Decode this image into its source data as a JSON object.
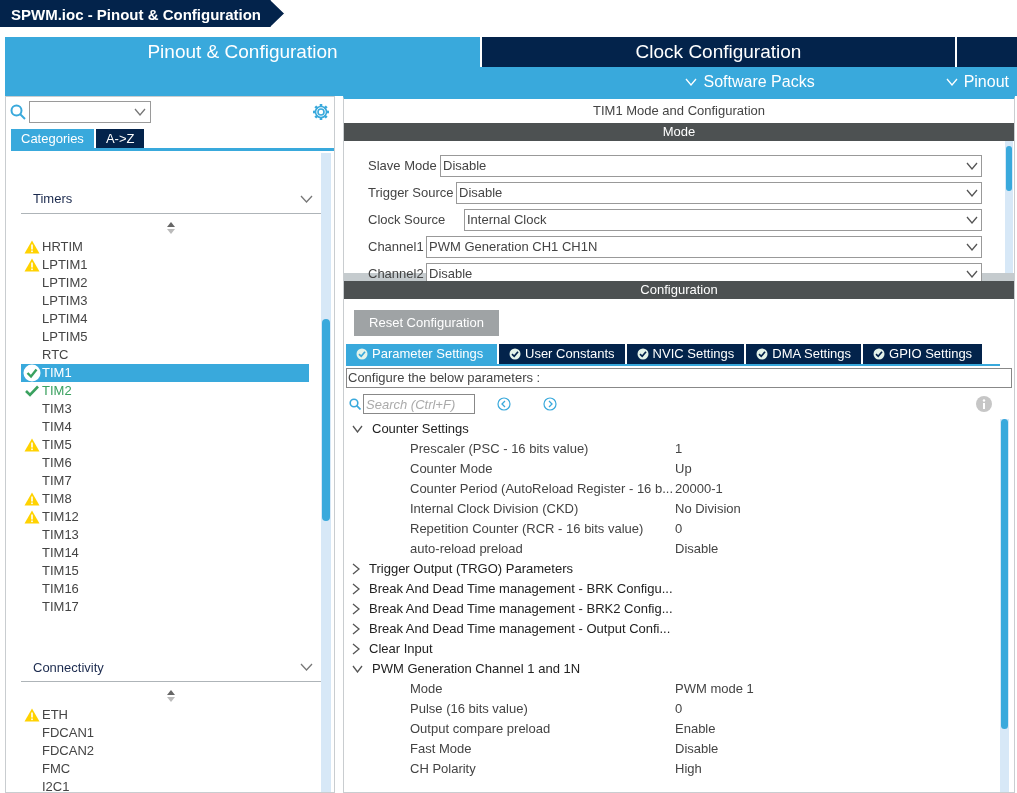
{
  "title_bar": {
    "title": "SPWM.ioc - Pinout & Configuration"
  },
  "main_tabs": [
    {
      "label": "Pinout & Configuration",
      "selected": true
    },
    {
      "label": "Clock Configuration",
      "selected": false
    }
  ],
  "sub_menu": [
    "Software Packs",
    "Pinout"
  ],
  "left_panel": {
    "view_tabs": [
      {
        "label": "Categories",
        "selected": true
      },
      {
        "label": "A->Z",
        "selected": false
      }
    ],
    "categories": [
      {
        "label": "Timers",
        "expanded": true,
        "items": [
          {
            "label": "HRTIM",
            "kind": "warning",
            "selected": false
          },
          {
            "label": "LPTIM1",
            "kind": "warning",
            "selected": false
          },
          {
            "label": "LPTIM2",
            "kind": "plain",
            "selected": false
          },
          {
            "label": "LPTIM3",
            "kind": "plain",
            "selected": false
          },
          {
            "label": "LPTIM4",
            "kind": "plain",
            "selected": false
          },
          {
            "label": "LPTIM5",
            "kind": "plain",
            "selected": false
          },
          {
            "label": "RTC",
            "kind": "plain",
            "selected": false
          },
          {
            "label": "TIM1",
            "kind": "ok",
            "selected": true
          },
          {
            "label": "TIM2",
            "kind": "ok",
            "selected": false
          },
          {
            "label": "TIM3",
            "kind": "plain",
            "selected": false
          },
          {
            "label": "TIM4",
            "kind": "plain",
            "selected": false
          },
          {
            "label": "TIM5",
            "kind": "warning",
            "selected": false
          },
          {
            "label": "TIM6",
            "kind": "plain",
            "selected": false
          },
          {
            "label": "TIM7",
            "kind": "plain",
            "selected": false
          },
          {
            "label": "TIM8",
            "kind": "warning",
            "selected": false
          },
          {
            "label": "TIM12",
            "kind": "warning",
            "selected": false
          },
          {
            "label": "TIM13",
            "kind": "plain",
            "selected": false
          },
          {
            "label": "TIM14",
            "kind": "plain",
            "selected": false
          },
          {
            "label": "TIM15",
            "kind": "plain",
            "selected": false
          },
          {
            "label": "TIM16",
            "kind": "plain",
            "selected": false
          },
          {
            "label": "TIM17",
            "kind": "plain",
            "selected": false
          }
        ]
      },
      {
        "label": "Connectivity",
        "expanded": true,
        "items": [
          {
            "label": "ETH",
            "kind": "warning",
            "selected": false
          },
          {
            "label": "FDCAN1",
            "kind": "plain",
            "selected": false
          },
          {
            "label": "FDCAN2",
            "kind": "plain",
            "selected": false
          },
          {
            "label": "FMC",
            "kind": "plain",
            "selected": false
          },
          {
            "label": "I2C1",
            "kind": "plain",
            "selected": false
          }
        ]
      }
    ]
  },
  "right_panel": {
    "title": "TIM1 Mode and Configuration",
    "mode": {
      "header": "Mode",
      "fields": [
        {
          "label": "Slave Mode",
          "value": "Disable"
        },
        {
          "label": "Trigger Source",
          "value": "Disable"
        },
        {
          "label": "Clock Source",
          "value": "Internal Clock"
        },
        {
          "label": "Channel1",
          "value": "PWM Generation CH1 CH1N"
        },
        {
          "label": "Channel2",
          "value": "Disable"
        }
      ]
    },
    "configuration": {
      "header": "Configuration",
      "reset_button": "Reset Configuration",
      "tabs": [
        {
          "label": "Parameter Settings",
          "selected": true
        },
        {
          "label": "User Constants",
          "selected": false
        },
        {
          "label": "NVIC Settings",
          "selected": false
        },
        {
          "label": "DMA Settings",
          "selected": false
        },
        {
          "label": "GPIO Settings",
          "selected": false
        }
      ],
      "description": "Configure the below parameters :",
      "search": {
        "placeholder": "Search (Ctrl+F)"
      },
      "sections": [
        {
          "label": "Counter Settings",
          "expanded": true,
          "params": [
            {
              "name": "Prescaler (PSC - 16 bits value)",
              "value": "1"
            },
            {
              "name": "Counter Mode",
              "value": "Up"
            },
            {
              "name": "Counter Period (AutoReload Register - 16 b...",
              "value": "20000-1"
            },
            {
              "name": "Internal Clock Division (CKD)",
              "value": "No Division"
            },
            {
              "name": "Repetition Counter (RCR - 16 bits value)",
              "value": "0"
            },
            {
              "name": "auto-reload preload",
              "value": "Disable"
            }
          ]
        },
        {
          "label": "Trigger Output (TRGO) Parameters",
          "expanded": false
        },
        {
          "label": "Break And Dead Time management - BRK Configu...",
          "expanded": false
        },
        {
          "label": "Break And Dead Time management - BRK2 Config...",
          "expanded": false
        },
        {
          "label": "Break And Dead Time management - Output Confi...",
          "expanded": false
        },
        {
          "label": "Clear Input",
          "expanded": false
        },
        {
          "label": "PWM Generation Channel 1 and 1N",
          "expanded": true,
          "params": [
            {
              "name": "Mode",
              "value": "PWM mode 1"
            },
            {
              "name": "Pulse (16 bits value)",
              "value": "0"
            },
            {
              "name": "Output compare preload",
              "value": "Enable"
            },
            {
              "name": "Fast Mode",
              "value": "Disable"
            },
            {
              "name": "CH Polarity",
              "value": "High"
            }
          ]
        }
      ]
    }
  }
}
